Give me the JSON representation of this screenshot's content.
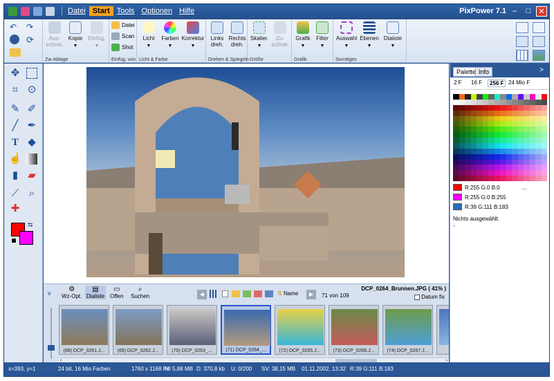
{
  "app": {
    "title": "PixPower 7.1"
  },
  "menu": {
    "items": [
      "Datei",
      "Start",
      "Tools",
      "Optionen",
      "Hilfe"
    ],
    "active": "Start"
  },
  "window_buttons": {
    "minimize": "–",
    "maximize": "□",
    "close": "✕"
  },
  "ribbon": {
    "groups": [
      {
        "label": "Zw-Ablage",
        "buttons": [
          "Aus-",
          "schnei.",
          "Kopie",
          "Einfüg."
        ]
      },
      {
        "label": "Einfüg. von",
        "buttons": [
          "Datei",
          "Scan",
          "Shot"
        ]
      },
      {
        "label": "Licht & Farbe",
        "buttons": [
          "Licht",
          "Farben",
          "Korrektur"
        ]
      },
      {
        "label": "Drehen & Spiegeln",
        "buttons": [
          "Links",
          "dreh.",
          "Rechts",
          "dreh."
        ]
      },
      {
        "label": "Größe",
        "buttons": [
          "Skalier.",
          "Zu-",
          "schnei."
        ]
      },
      {
        "label": "Grafik",
        "buttons": [
          "Grafik",
          "Filter"
        ]
      },
      {
        "label": "Sonstiges",
        "buttons": [
          "Auswahl",
          "Ebenen",
          "Diaiiste"
        ]
      }
    ]
  },
  "panel": {
    "tabs": [
      "Palette",
      "Info"
    ],
    "collapse": ">",
    "color_depth_tabs": [
      "2 F",
      "16 F",
      "256 F",
      "24 Mio F"
    ],
    "active_depth": "256 F",
    "colors": [
      {
        "text": "R:255 G:0 B:0",
        "hex": "#ff0000"
      },
      {
        "text": "R:255 G:0 B:255",
        "hex": "#ff00ff"
      },
      {
        "text": "R:39  G:111  B:183",
        "hex": "#276fb7"
      }
    ],
    "more": "...",
    "status": "Nichts ausgewählt.",
    "dash": "-"
  },
  "browser": {
    "toggle": "v",
    "buttons": [
      "Wz-Opt.",
      "Dialiste",
      "Offen",
      "Suchen"
    ],
    "sort_label": "Name",
    "file_info": "DCP_0264_Brunnen.JPG  ( 41% )",
    "count": "71 von 109",
    "date_fix": "Datum fix",
    "thumbs": [
      {
        "caption": "(68) DCP_0261.J...",
        "c1": "#6c8fbf",
        "c2": "#8f7a5a"
      },
      {
        "caption": "(69) DCP_0262.J...",
        "c1": "#7e9cc4",
        "c2": "#837359"
      },
      {
        "caption": "(70) DCP_0263_...",
        "c1": "#c9c6c2",
        "c2": "#5a5f7a"
      },
      {
        "caption": "(71) DCP_0264_...",
        "c1": "#3b6aae",
        "c2": "#b39a7f"
      },
      {
        "caption": "(72) DCP_0265.J...",
        "c1": "#e8d14a",
        "c2": "#37b7d8"
      },
      {
        "caption": "(73) DCP_0266.J...",
        "c1": "#6a8a48",
        "c2": "#c55a5a"
      },
      {
        "caption": "(74) DCP_0267.J...",
        "c1": "#6f9b4d",
        "c2": "#4d9fd6"
      },
      {
        "caption": "",
        "c1": "#4a76c0",
        "c2": "#8bb6e0"
      }
    ]
  },
  "status": {
    "coords": "x=393, y=1",
    "depth": "24 bit, 16 Mio Farben",
    "size": "1760 x 1168 Pxl",
    "memory": "M:  5,88 MB",
    "disk": "D:  370,8 kb",
    "undo": "U: 0/200",
    "sv": "SV:  38,15 MB",
    "date": "01.11.2002, 13:32",
    "rgb": "R:39  G:111  B:183"
  }
}
